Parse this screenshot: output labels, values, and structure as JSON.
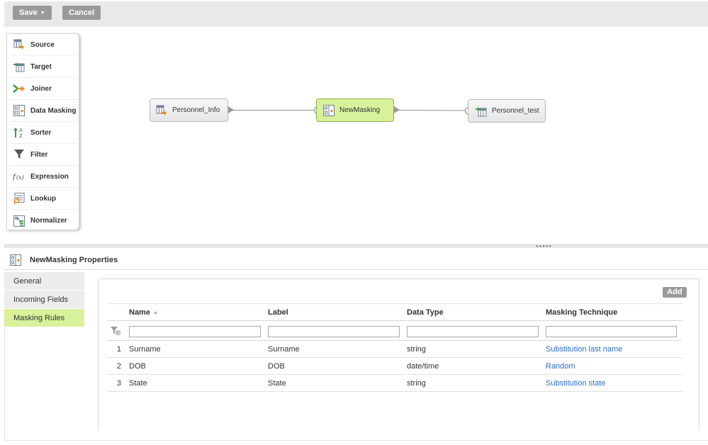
{
  "toolbar": {
    "save_label": "Save",
    "cancel_label": "Cancel"
  },
  "palette": {
    "items": [
      {
        "label": "Source",
        "icon": "source-icon"
      },
      {
        "label": "Target",
        "icon": "target-icon"
      },
      {
        "label": "Joiner",
        "icon": "joiner-icon"
      },
      {
        "label": "Data Masking",
        "icon": "data-masking-icon"
      },
      {
        "label": "Sorter",
        "icon": "sorter-icon"
      },
      {
        "label": "Filter",
        "icon": "filter-icon"
      },
      {
        "label": "Expression",
        "icon": "expression-icon"
      },
      {
        "label": "Lookup",
        "icon": "lookup-icon"
      },
      {
        "label": "Normalizer",
        "icon": "normalizer-icon"
      }
    ]
  },
  "mapping": {
    "nodes": [
      {
        "label": "Personnel_Info",
        "type": "source"
      },
      {
        "label": "NewMasking",
        "type": "data-masking",
        "selected": true
      },
      {
        "label": "Personnel_test",
        "type": "target"
      }
    ]
  },
  "properties": {
    "title": "NewMasking Properties",
    "tabs": [
      {
        "label": "General"
      },
      {
        "label": "Incoming Fields"
      },
      {
        "label": "Masking Rules",
        "active": true
      }
    ],
    "add_label": "Add",
    "grid": {
      "columns": [
        "Name",
        "Label",
        "Data Type",
        "Masking Technique"
      ],
      "rows": [
        {
          "num": "1",
          "name": "Surname",
          "label": "Surname",
          "type": "string",
          "technique": "Substitution last name"
        },
        {
          "num": "2",
          "name": "DOB",
          "label": "DOB",
          "type": "date/time",
          "technique": "Random"
        },
        {
          "num": "3",
          "name": "State",
          "label": "State",
          "type": "string",
          "technique": "Substitution state"
        }
      ]
    }
  },
  "colors": {
    "selected_green": "#d7f29a",
    "button_gray": "#9a9a9a",
    "link_blue": "#2b6ec8"
  }
}
